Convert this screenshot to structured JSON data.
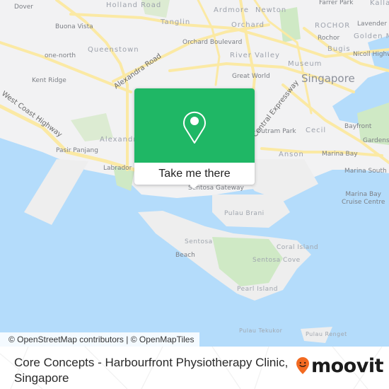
{
  "map": {
    "colors": {
      "land": "#f2f2f3",
      "water": "#b4dcfb",
      "park": "#cfe9c5",
      "road": "#fbe9a4",
      "popup_green": "#1fb765",
      "brand_orange": "#f26a21"
    },
    "labels": {
      "dover": "Dover",
      "holland_road": "Holland Road",
      "buona_vista": "Buona Vista",
      "tanglin": "Tanglin",
      "queenstown": "Queenstown",
      "one_north": "one-north",
      "kent_ridge": "Kent Ridge",
      "alexandra_road": "Alexandra Road",
      "west_coast_highway": "West Coast Highway",
      "alexandra": "Alexandra",
      "pasir_panjang": "Pasir Panjang",
      "labrador_park": "Labrador Park",
      "ardmore": "Ardmore",
      "newton": "Newton",
      "farrer_park": "Farrer Park",
      "kallang": "Kallang",
      "orchard": "Orchard",
      "orchard_boulevard": "Orchard Boulevard",
      "rochor_district": "ROCHOR",
      "rochor": "Rochor",
      "lavender": "Lavender",
      "golden_mile": "Golden Mile",
      "bugis": "Bugis",
      "nicoll_highway": "Nicoll Highway",
      "river_valley": "River Valley",
      "museum": "Museum",
      "great_world": "Great World",
      "singapore": "Singapore",
      "central_expressway": "Central Expressway",
      "outram_park": "Outram Park",
      "cecil": "Cecil",
      "bayfront": "Bayfront",
      "gardens": "Gardens",
      "anson": "Anson",
      "marina_bay": "Marina Bay",
      "marina_south_pier": "Marina South Pier",
      "marina_bay_cruise_centre": "Marina Bay\nCruise Centre",
      "marina": "Marina",
      "sentosa_gateway": "Sentosa Gateway",
      "pulau_brani": "Pulau Brani",
      "sentosa": "Sentosa",
      "beach": "Beach",
      "coral_island": "Coral Island",
      "sentosa_cove": "Sentosa Cove",
      "pearl_island": "Pearl Island",
      "pulau_tekukor": "Pulau Tekukor",
      "pulau_renget": "Pulau Renget"
    },
    "attribution": "© OpenStreetMap contributors | © OpenMapTiles"
  },
  "popup": {
    "icon": "map-pin-icon",
    "cta_label": "Take me there"
  },
  "footer": {
    "place_title": "Core Concepts - Harbourfront Physiotherapy Clinic, Singapore",
    "brand": "moovit",
    "brand_icon": "moovit-smiley-pin-icon"
  }
}
